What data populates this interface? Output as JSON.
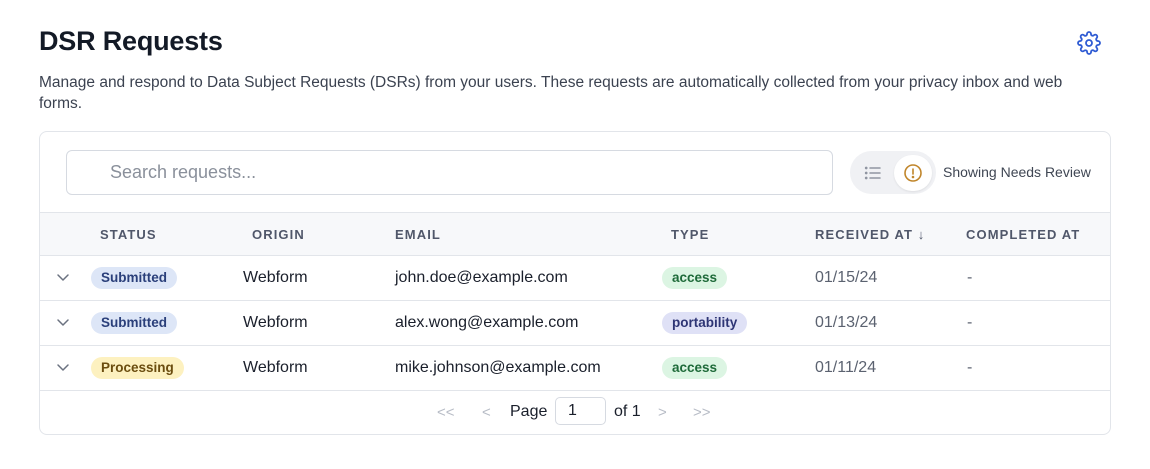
{
  "header": {
    "title": "DSR Requests",
    "settings_icon": "gear-icon",
    "description": "Manage and respond to Data Subject Requests (DSRs) from your users. These requests are automatically collected from your privacy inbox and web forms."
  },
  "search": {
    "placeholder": "Search requests...",
    "value": ""
  },
  "filter": {
    "options": [
      "list-icon",
      "alert-circle-icon"
    ],
    "active": "alert-circle-icon",
    "label": "Showing Needs Review"
  },
  "table": {
    "columns": [
      "STATUS",
      "ORIGIN",
      "EMAIL",
      "TYPE",
      "RECEIVED AT",
      "COMPLETED AT"
    ],
    "sort_indicator": "↓",
    "rows": [
      {
        "status": "Submitted",
        "origin": "Webform",
        "email": "john.doe@example.com",
        "type": "access",
        "received_at": "01/15/24",
        "completed_at": "-"
      },
      {
        "status": "Submitted",
        "origin": "Webform",
        "email": "alex.wong@example.com",
        "type": "portability",
        "received_at": "01/13/24",
        "completed_at": "-"
      },
      {
        "status": "Processing",
        "origin": "Webform",
        "email": "mike.johnson@example.com",
        "type": "access",
        "received_at": "01/11/24",
        "completed_at": "-"
      }
    ]
  },
  "pagination": {
    "first": "<<",
    "prev": "<",
    "page_label": "Page",
    "current_page": "1",
    "of_label": "of 1",
    "next": ">",
    "last": ">>"
  },
  "colors": {
    "submitted_bg": "#dde6f7",
    "submitted_fg": "#2a3f7a",
    "processing_bg": "#fdf1c0",
    "processing_fg": "#6b4d0f",
    "access_bg": "#dcf5e3",
    "access_fg": "#1f6b3a",
    "portability_bg": "#dfe1f6",
    "portability_fg": "#2e3575",
    "accent": "#2f5bd3",
    "warning": "#c0852a"
  }
}
